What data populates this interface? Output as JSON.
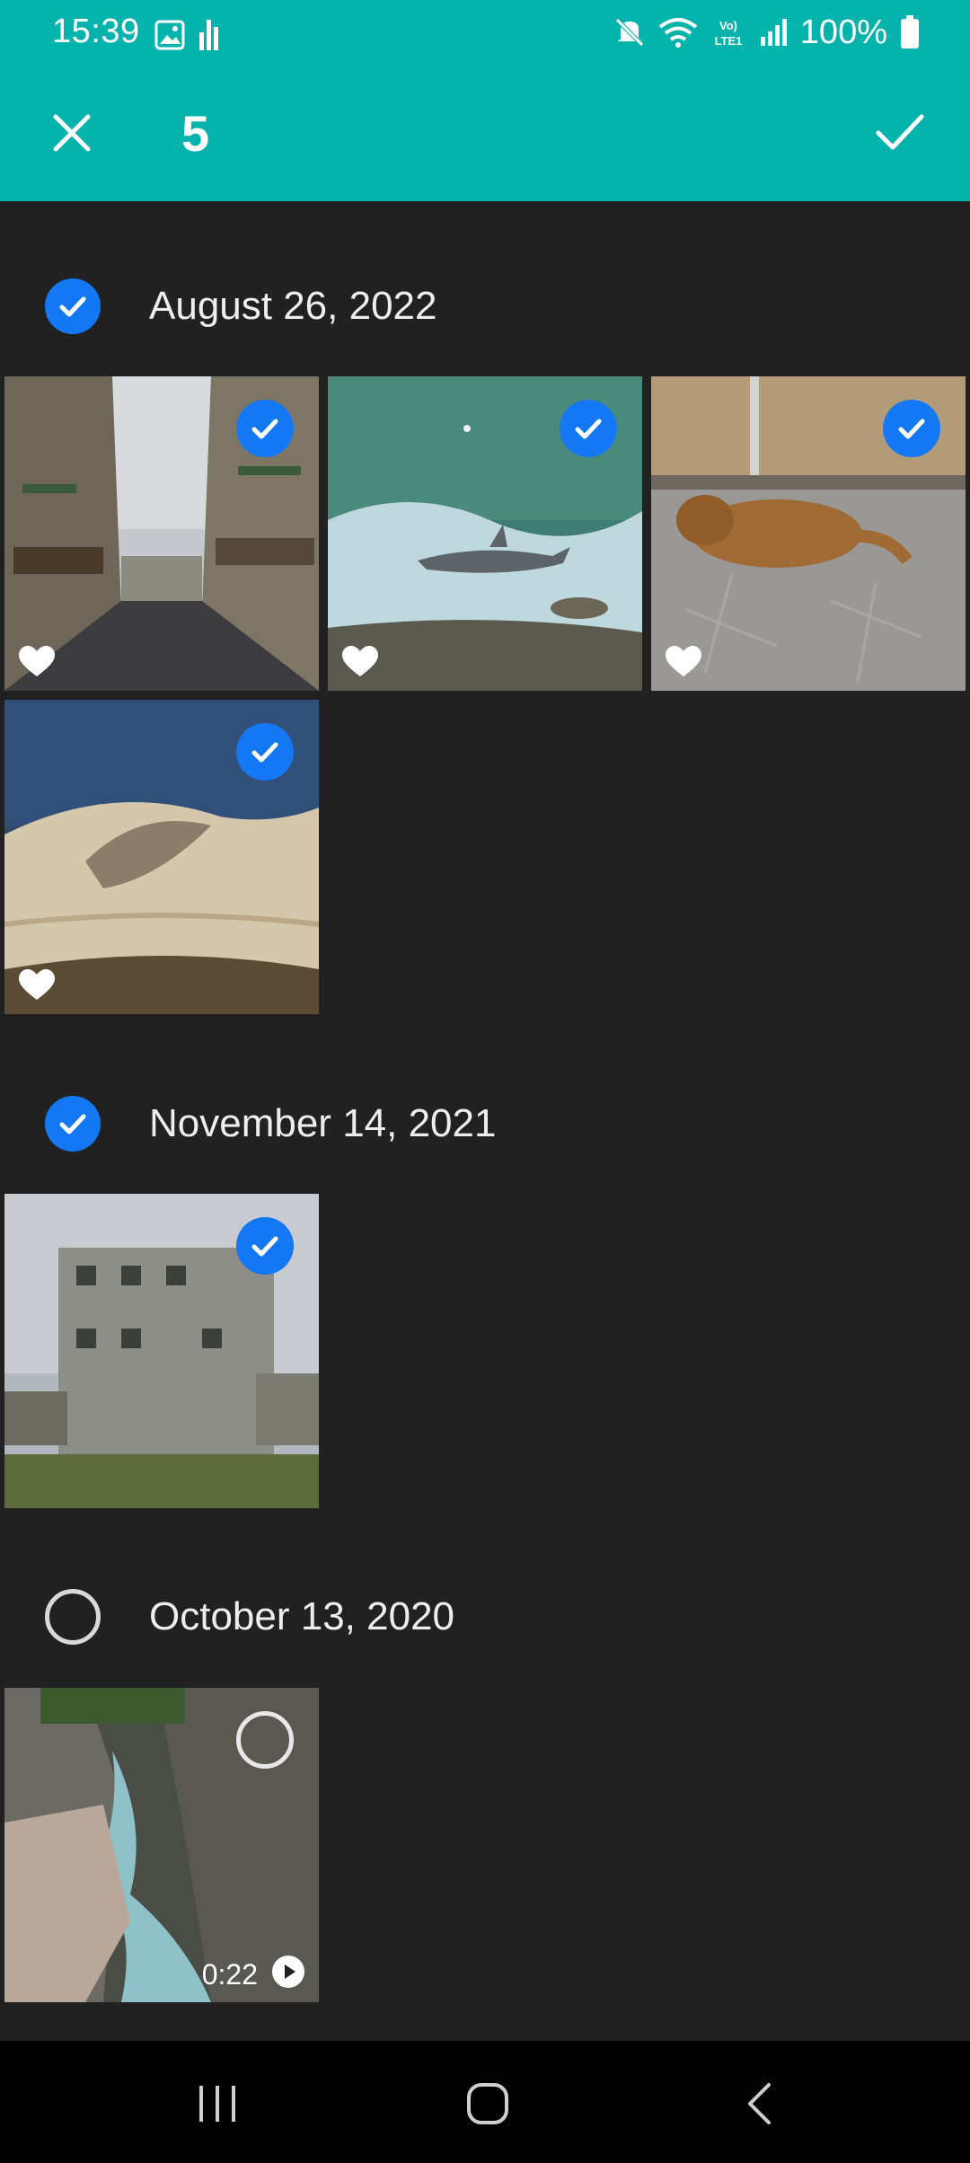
{
  "status": {
    "time": "15:39",
    "battery_pct": "100%",
    "icons": [
      "image-icon",
      "bars-icon",
      "mute-icon",
      "wifi-icon",
      "volte-icon",
      "signal-icon",
      "battery-icon"
    ]
  },
  "appbar": {
    "selected_count": "5",
    "close_icon": "close-icon",
    "done_icon": "check-icon"
  },
  "groups": [
    {
      "date": "August 26, 2022",
      "selected": true
    },
    {
      "date": "November 14, 2021",
      "selected": true
    },
    {
      "date": "October 13, 2020",
      "selected": false
    }
  ],
  "items": [
    {
      "scene": "street",
      "selected": true,
      "favorite": true
    },
    {
      "scene": "aquarium",
      "selected": true,
      "favorite": true
    },
    {
      "scene": "dog",
      "selected": true,
      "favorite": true
    },
    {
      "scene": "coast",
      "selected": true,
      "favorite": true
    },
    {
      "scene": "building",
      "selected": true,
      "favorite": false
    },
    {
      "scene": "river",
      "selected": false,
      "favorite": false,
      "duration": "0:22"
    }
  ],
  "colors": {
    "accent": "#04b3ac",
    "selection": "#1478f5",
    "background": "#212121"
  }
}
